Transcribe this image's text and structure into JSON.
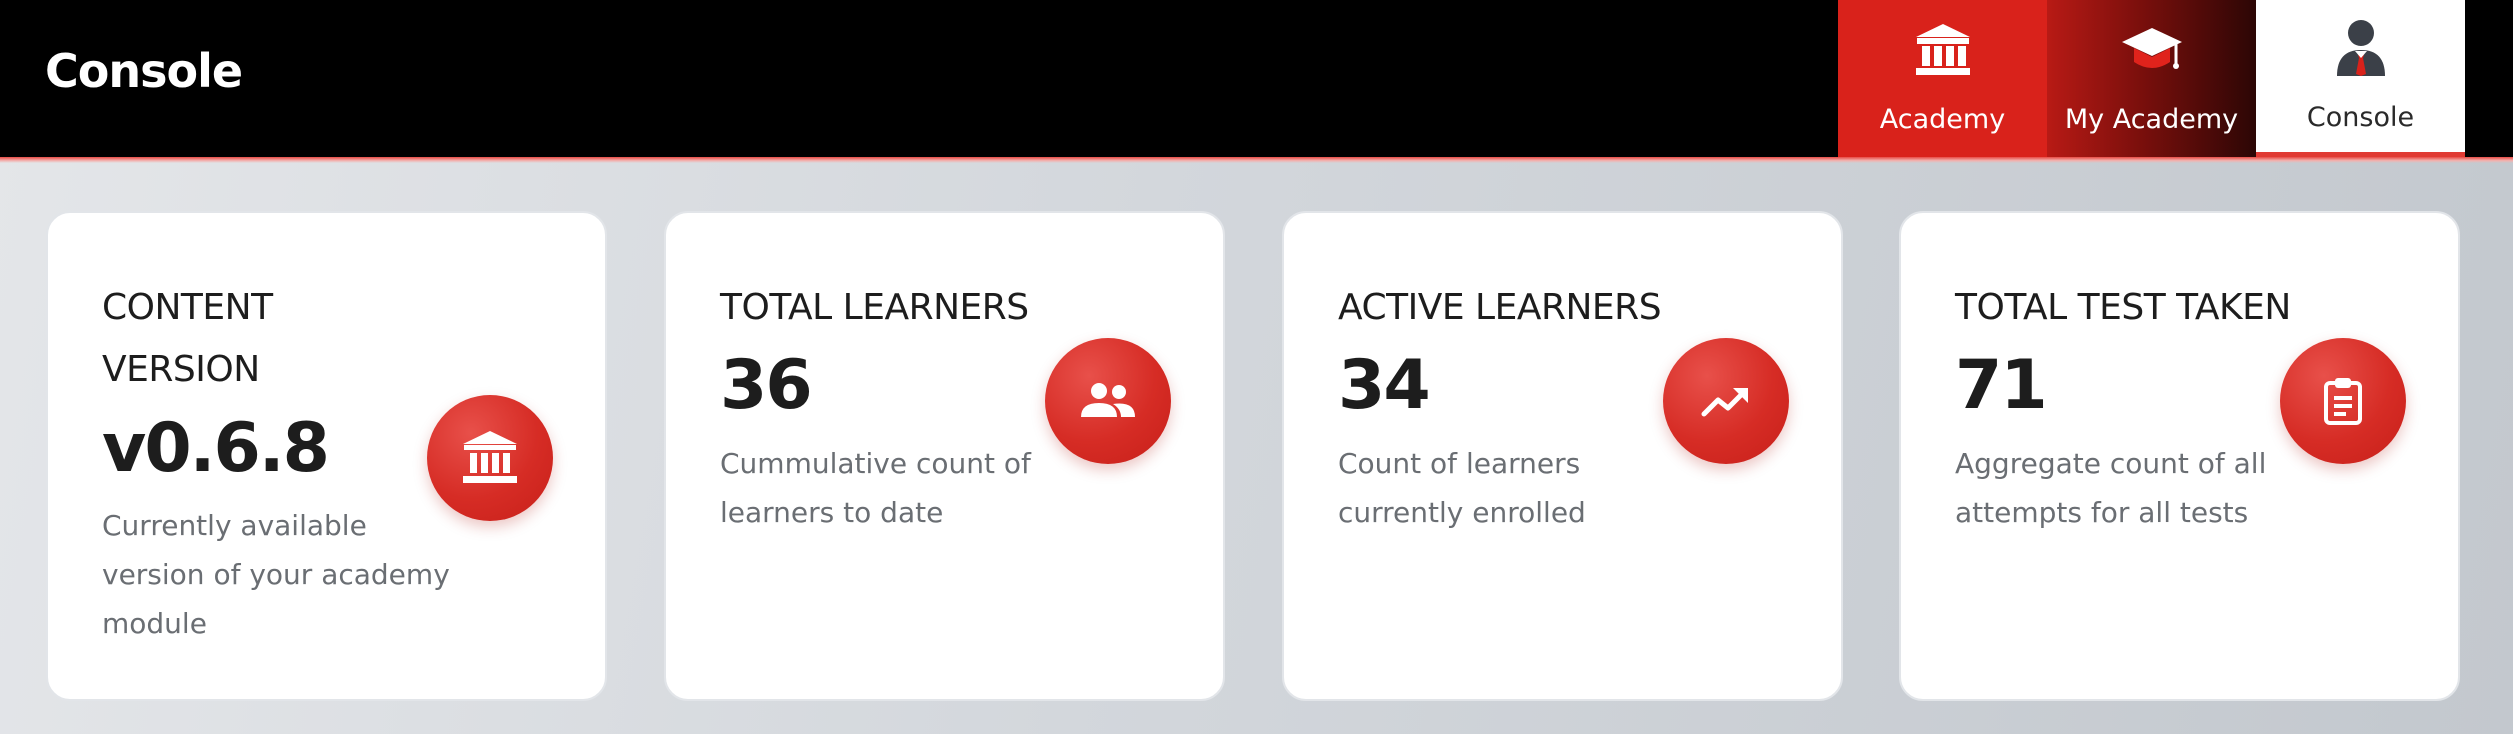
{
  "header": {
    "title": "Console",
    "nav": [
      {
        "label": "Academy",
        "icon": "bank-icon"
      },
      {
        "label": "My Academy",
        "icon": "graduation-cap-icon"
      },
      {
        "label": "Console",
        "icon": "user-icon"
      }
    ],
    "accent_color": "#d9221b"
  },
  "cards": [
    {
      "title_line1": "CONTENT",
      "title_line2": "VERSION",
      "value": "v0.6.8",
      "desc_line1": "Currently available",
      "desc_line2": "version of your academy",
      "desc_line3": "module",
      "icon": "bank-icon"
    },
    {
      "title": "TOTAL LEARNERS",
      "value": "36",
      "desc_line1": "Cummulative count of",
      "desc_line2": "learners to date",
      "icon": "people-icon"
    },
    {
      "title": "ACTIVE LEARNERS",
      "value": "34",
      "desc_line1": "Count of learners",
      "desc_line2": "currently enrolled",
      "icon": "trending-up-icon"
    },
    {
      "title": "TOTAL TEST TAKEN",
      "value": "71",
      "desc_line1": "Aggregate count of all",
      "desc_line2": "attempts for all tests",
      "icon": "clipboard-icon"
    }
  ]
}
